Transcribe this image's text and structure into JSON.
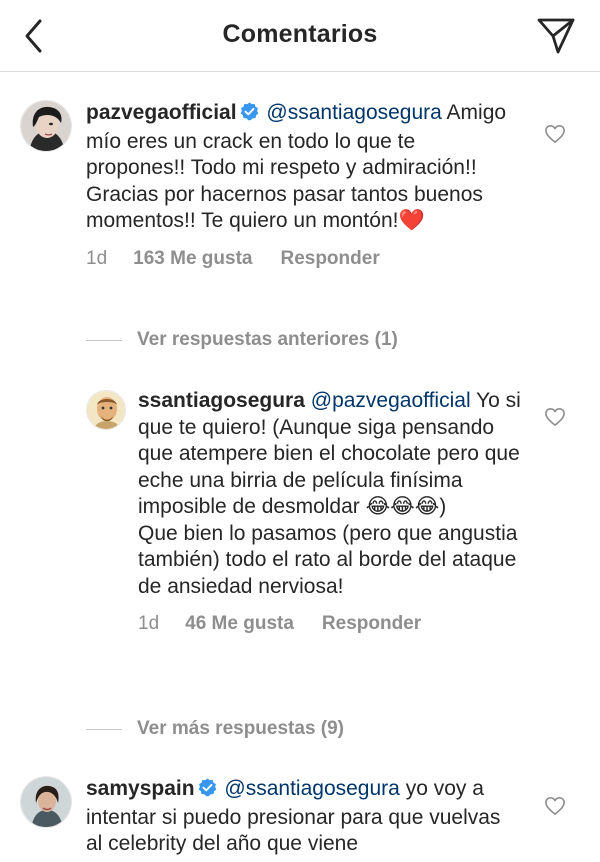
{
  "header": {
    "title": "Comentarios",
    "back_icon": "chevron-left-icon",
    "send_icon": "paper-plane-icon"
  },
  "comments": [
    {
      "username": "pazvegaofficial",
      "verified": true,
      "mention": "@ssantiagosegura",
      "text": "Amigo mío eres un crack en todo lo que te propones!! Todo mi respeto y admiración!! Gracias por hacernos pasar tantos buenos momentos!! Te quiero un montón!",
      "emoji": "❤️",
      "time": "1d",
      "likes": "163 Me gusta",
      "reply_label": "Responder"
    }
  ],
  "previous_replies": "Ver respuestas anteriores (1)",
  "reply": {
    "username": "ssantiagosegura",
    "mention": "@pazvegaofficial",
    "text_part1": "Yo si que te quiero! (Aunque siga pensando que atempere bien el chocolate pero que eche una birria de película finísima imposible de desmoldar",
    "emoji": "😂😂😂",
    "text_part2": ")",
    "text_part3": "Que bien lo pasamos (pero que angustia también) todo el rato al borde del ataque de ansiedad nerviosa!",
    "time": "1d",
    "likes": "46 Me gusta",
    "reply_label": "Responder"
  },
  "more_replies": "Ver más respuestas (9)",
  "comment2": {
    "username": "samyspain",
    "verified": true,
    "mention": "@ssantiagosegura",
    "text": "yo voy a intentar si puedo presionar para que vuelvas al celebrity del año que viene"
  },
  "colors": {
    "text": "#262626",
    "muted": "#8e8e8e",
    "mention": "#003569",
    "verified": "#3897f0",
    "heart": "#e0245e"
  }
}
